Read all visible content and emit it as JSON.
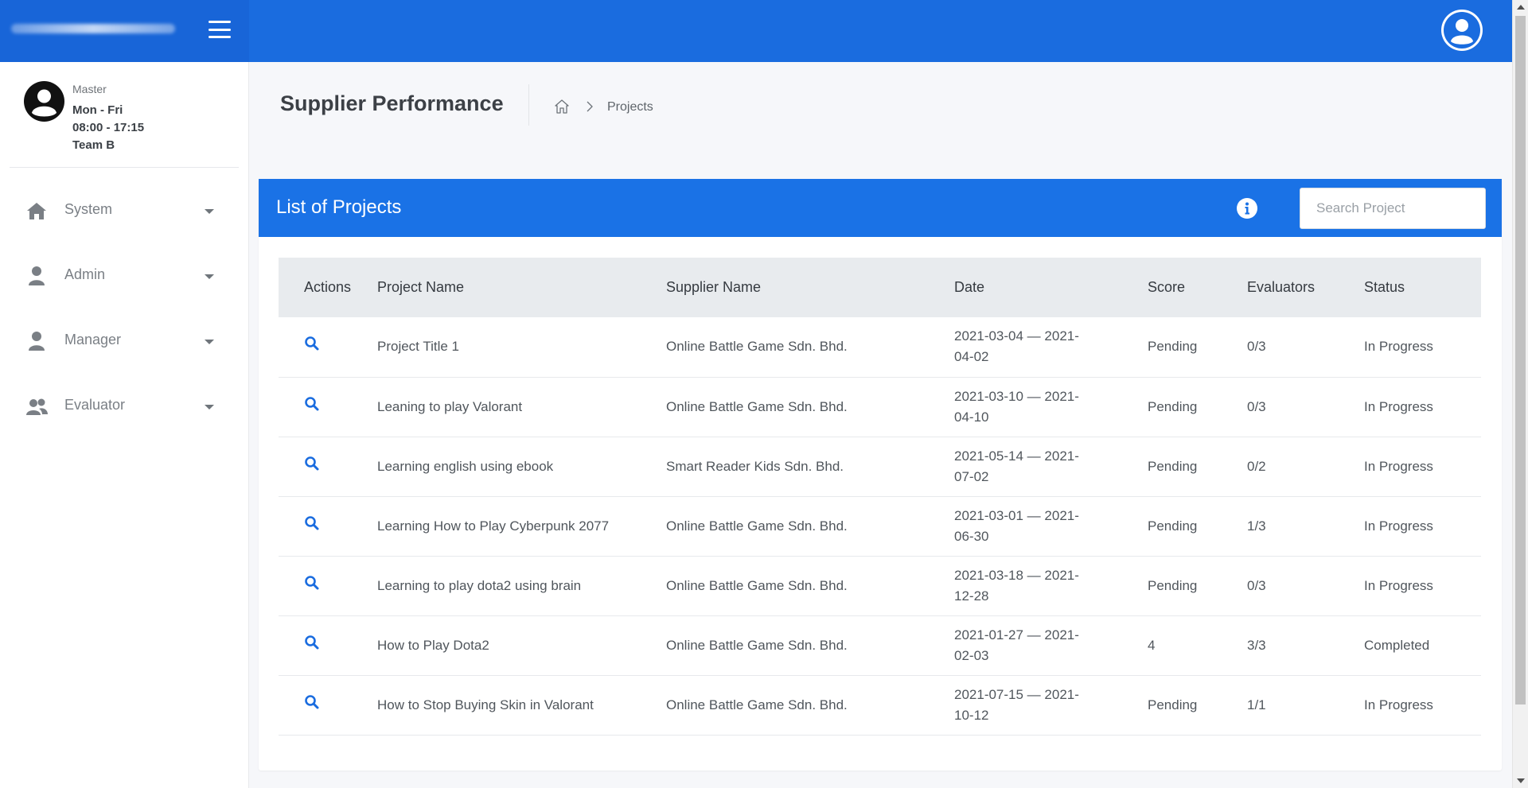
{
  "profile": {
    "role": "Master",
    "days": "Mon - Fri",
    "hours": "08:00 - 17:15",
    "team": "Team B"
  },
  "sidebar": {
    "items": [
      {
        "label": "System",
        "icon": "home-icon"
      },
      {
        "label": "Admin",
        "icon": "user-icon"
      },
      {
        "label": "Manager",
        "icon": "user-icon"
      },
      {
        "label": "Evaluator",
        "icon": "users-icon"
      }
    ]
  },
  "header": {
    "title": "Supplier Performance",
    "breadcrumb_current": "Projects"
  },
  "card": {
    "title": "List of Projects",
    "search_placeholder": "Search Project"
  },
  "table": {
    "columns": [
      "Actions",
      "Project Name",
      "Supplier Name",
      "Date",
      "Score",
      "Evaluators",
      "Status"
    ],
    "rows": [
      {
        "name": "Project Title 1",
        "supplier": "Online Battle Game Sdn. Bhd.",
        "date": "2021-03-04 — 2021-04-02",
        "score": "Pending",
        "evaluators": "0/3",
        "status": "In Progress"
      },
      {
        "name": "Leaning to play Valorant",
        "supplier": "Online Battle Game Sdn. Bhd.",
        "date": "2021-03-10 — 2021-04-10",
        "score": "Pending",
        "evaluators": "0/3",
        "status": "In Progress"
      },
      {
        "name": "Learning english using ebook",
        "supplier": "Smart Reader Kids Sdn. Bhd.",
        "date": "2021-05-14 — 2021-07-02",
        "score": "Pending",
        "evaluators": "0/2",
        "status": "In Progress"
      },
      {
        "name": "Learning How to Play Cyberpunk 2077",
        "supplier": "Online Battle Game Sdn. Bhd.",
        "date": "2021-03-01 — 2021-06-30",
        "score": "Pending",
        "evaluators": "1/3",
        "status": "In Progress"
      },
      {
        "name": "Learning to play dota2 using brain",
        "supplier": "Online Battle Game Sdn. Bhd.",
        "date": "2021-03-18 — 2021-12-28",
        "score": "Pending",
        "evaluators": "0/3",
        "status": "In Progress"
      },
      {
        "name": "How to Play Dota2",
        "supplier": "Online Battle Game Sdn. Bhd.",
        "date": "2021-01-27 — 2021-02-03",
        "score": "4",
        "evaluators": "3/3",
        "status": "Completed"
      },
      {
        "name": "How to Stop Buying Skin in Valorant",
        "supplier": "Online Battle Game Sdn. Bhd.",
        "date": "2021-07-15 — 2021-10-12",
        "score": "Pending",
        "evaluators": "1/1",
        "status": "In Progress"
      }
    ]
  },
  "colors": {
    "topbar": "#1a6cdf",
    "card_header": "#1a72e6",
    "action_icon": "#1a6cdf"
  }
}
